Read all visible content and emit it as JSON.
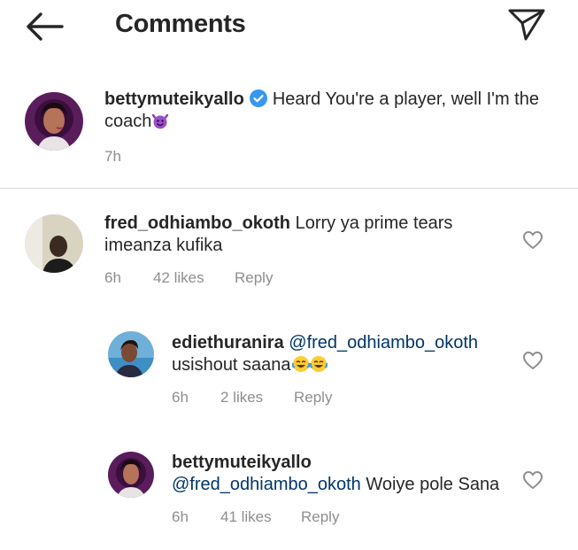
{
  "header": {
    "title": "Comments",
    "back_icon": "arrow-left-icon",
    "send_icon": "paper-plane-icon"
  },
  "caption": {
    "username": "bettymuteikyallo",
    "text": "Heard You're a player, well I'm the coach",
    "emoji": "smiling-devil-emoji",
    "time": "7h",
    "verified_color": "#3897f0"
  },
  "comments": [
    {
      "username": "fred_odhiambo_okoth",
      "text": "Lorry ya prime tears imeanza kufika",
      "time": "6h",
      "likes": "42 likes",
      "reply": "Reply"
    },
    {
      "username": "ediethuranira",
      "mention": "@fred_odhiambo_okoth",
      "text": "usishout saana",
      "emoji": "tears-of-joy-emoji",
      "time": "6h",
      "likes": "2 likes",
      "reply": "Reply"
    },
    {
      "username": "bettymuteikyallo",
      "mention": "@fred_odhiambo_okoth",
      "text": "Woiye pole Sana",
      "time": "6h",
      "likes": "41 likes",
      "reply": "Reply"
    }
  ],
  "colors": {
    "text": "#262626",
    "secondary": "#8e8e8e",
    "mention": "#003569",
    "divider": "#dbdbdb"
  }
}
